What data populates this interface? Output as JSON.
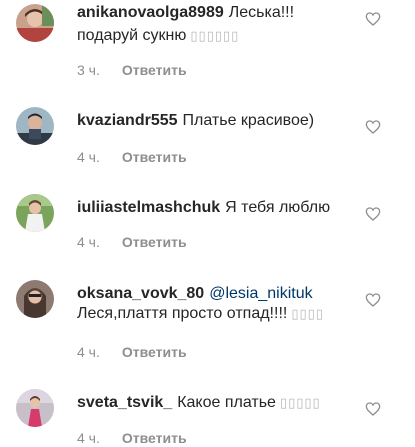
{
  "comments": [
    {
      "username": "anikanovaolga8989",
      "text_line1": "Леська!!!",
      "text_line2": "подаруй сукню",
      "emoji": "▯▯▯▯▯▯",
      "time": "3 ч.",
      "reply": "Ответить"
    },
    {
      "username": "kvaziandr555",
      "text": "Платье красивое)",
      "time": "4 ч.",
      "reply": "Ответить"
    },
    {
      "username": "iuliiastelmashchuk",
      "text": "Я тебя люблю",
      "time": "4 ч.",
      "reply": "Ответить"
    },
    {
      "username": "oksana_vovk_80",
      "mention": "@lesia_nikituk",
      "text_line2": "Леся,плаття просто отпад!!!!",
      "emoji": "▯▯▯▯",
      "time": "4 ч.",
      "reply": "Ответить"
    },
    {
      "username": "sveta_tsvik_",
      "text": "Какое платье",
      "emoji": "▯▯▯▯▯",
      "time": "4 ч.",
      "reply": "Ответить"
    }
  ],
  "icons": {
    "like": "heart-outline-icon"
  },
  "colors": {
    "username": "#262626",
    "meta": "#8e8e8e",
    "mention": "#00376b",
    "heart": "#8e8e8e"
  }
}
